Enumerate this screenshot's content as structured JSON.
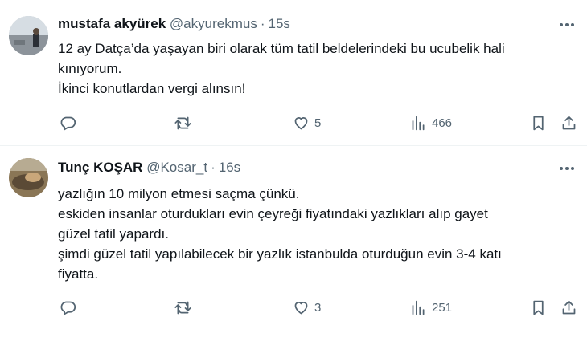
{
  "tweets": [
    {
      "author": "mustafa akyürek",
      "handle": "@akyurekmus",
      "separator": "·",
      "time": "15s",
      "lines": [
        "12 ay Datça’da yaşayan biri olarak tüm tatil beldelerindeki bu ucubelik hali",
        "kınıyorum.",
        "İkinci konutlardan vergi alınsın!"
      ],
      "likes": "5",
      "views": "466"
    },
    {
      "author": "Tunç KOŞAR",
      "handle": "@Kosar_t",
      "separator": "·",
      "time": "16s",
      "lines": [
        "yazlığın 10 milyon etmesi saçma çünkü.",
        "eskiden insanlar oturdukları evin çeyreği fiyatındaki yazlıkları alıp gayet",
        "güzel tatil yapardı.",
        "şimdi güzel tatil yapılabilecek bir yazlık istanbulda oturduğun evin 3-4 katı",
        "fiyatta."
      ],
      "likes": "3",
      "views": "251"
    }
  ],
  "icons": {
    "reply": "reply-icon",
    "retweet": "retweet-icon",
    "like": "heart-icon",
    "views": "views-icon",
    "bookmark": "bookmark-icon",
    "share": "share-icon",
    "more": "more-icon"
  },
  "colors": {
    "text": "#0f1419",
    "secondary": "#536471",
    "divider": "#eff3f4"
  }
}
